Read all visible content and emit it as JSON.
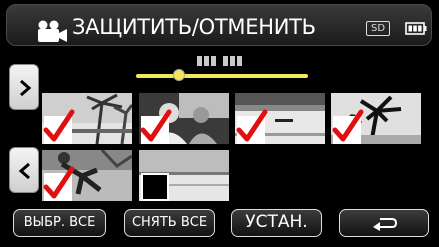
{
  "header": {
    "title": "ЗАЩИТИТЬ/ОТМЕНИТЬ",
    "mode_icon": "video-camera-icon",
    "media_icon_label": "SD",
    "battery_icon": "battery-full-icon"
  },
  "date_indicator": "▪▪.▪▪",
  "navigation": {
    "next_icon": "chevron-right-icon",
    "prev_icon": "chevron-left-icon"
  },
  "thumbnails": [
    {
      "scene": "palms-beach",
      "checked": true
    },
    {
      "scene": "people-dark",
      "checked": true
    },
    {
      "scene": "lake-boat",
      "checked": true
    },
    {
      "scene": "palm-silhouette",
      "checked": true
    },
    {
      "scene": "running-person",
      "checked": true
    },
    {
      "scene": "sea-horizon",
      "checked": false
    }
  ],
  "buttons": {
    "select_all": "ВЫБР. ВСЕ",
    "deselect_all": "СНЯТЬ ВСЕ",
    "set": "УСТАН.",
    "back_icon": "return-arrow-icon"
  }
}
